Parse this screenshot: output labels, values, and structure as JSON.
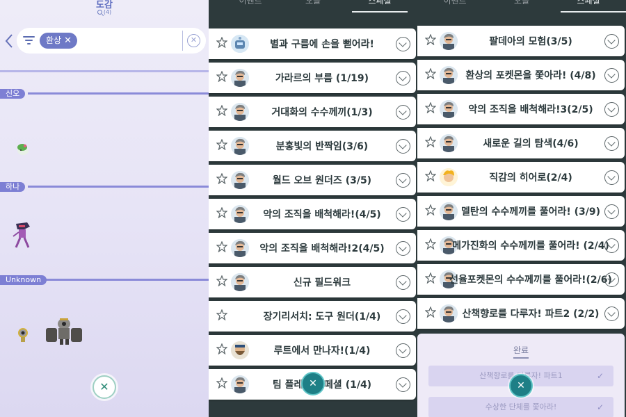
{
  "pokedex": {
    "title": "도감",
    "count": "(4)",
    "filter_chip": "환상",
    "chip_close": "✕",
    "clear_glyph": "✕",
    "regions": [
      "신오",
      "하나",
      "Unknown"
    ],
    "close_glyph": "✕"
  },
  "research": {
    "tabs": [
      "이벤트",
      "오늘",
      "스페셜"
    ],
    "middle_rows": [
      {
        "label": "별과 구름에 손을 뻗어라!",
        "avatar": "robot"
      },
      {
        "label": "가라르의 부름 (1/19)",
        "avatar": "willow"
      },
      {
        "label": "거대화의 수수께끼(1/3)",
        "avatar": "willow"
      },
      {
        "label": "분홍빛의 반짝임(3/6)",
        "avatar": "willow"
      },
      {
        "label": "월드 오브 원더즈 (3/5)",
        "avatar": "willow"
      },
      {
        "label": "악의 조직을 배척해라!(4/5)",
        "avatar": "willow"
      },
      {
        "label": "악의 조직을 배척해라!2(4/5)",
        "avatar": "willow"
      },
      {
        "label": "신규 필드워크",
        "avatar": "willow"
      },
      {
        "label": "장기리서치: 도구 원더(1/4)",
        "avatar": "none"
      },
      {
        "label": "루트에서 만나자!(1/4)",
        "avatar": "bearded"
      },
      {
        "label": "팀 플레이 스페셜 (1/4)",
        "avatar": "willow"
      }
    ],
    "right_rows": [
      {
        "label": "팔데아의 모험(3/5)",
        "avatar": "willow"
      },
      {
        "label": "환상의 포켓몬을 쫓아라! (4/8)",
        "avatar": "willow"
      },
      {
        "label": "악의 조직을 배척해라!3(2/5)",
        "avatar": "willow"
      },
      {
        "label": "새로운 길의 탐색(4/6)",
        "avatar": "willow"
      },
      {
        "label": "직감의 히어로(2/4)",
        "avatar": "spark"
      },
      {
        "label": "멜탄의 수수께끼를 풀어라! (3/9)",
        "avatar": "willow"
      },
      {
        "label": "메가진화의 수수께끼를 풀어라! (2/4)",
        "avatar": "willow"
      },
      {
        "label": "선율포켓몬의 수수께끼를 풀어라!(2/6)",
        "avatar": "willow"
      },
      {
        "label": "산책향로를 다루자! 파트2 (2/2)",
        "avatar": "willow"
      }
    ],
    "completed_title": "완료",
    "completed_rows": [
      "산책향로를 다루자! 파트1",
      "수상한 단체를 쫓아라!"
    ],
    "check_glyph": "✓",
    "close_glyph": "✕"
  },
  "colors": {
    "panel_bg": "#2d3a3c",
    "accent_teal": "#1e7f86",
    "region_tag": "#7d7fd4",
    "chip": "#6e79c6"
  }
}
